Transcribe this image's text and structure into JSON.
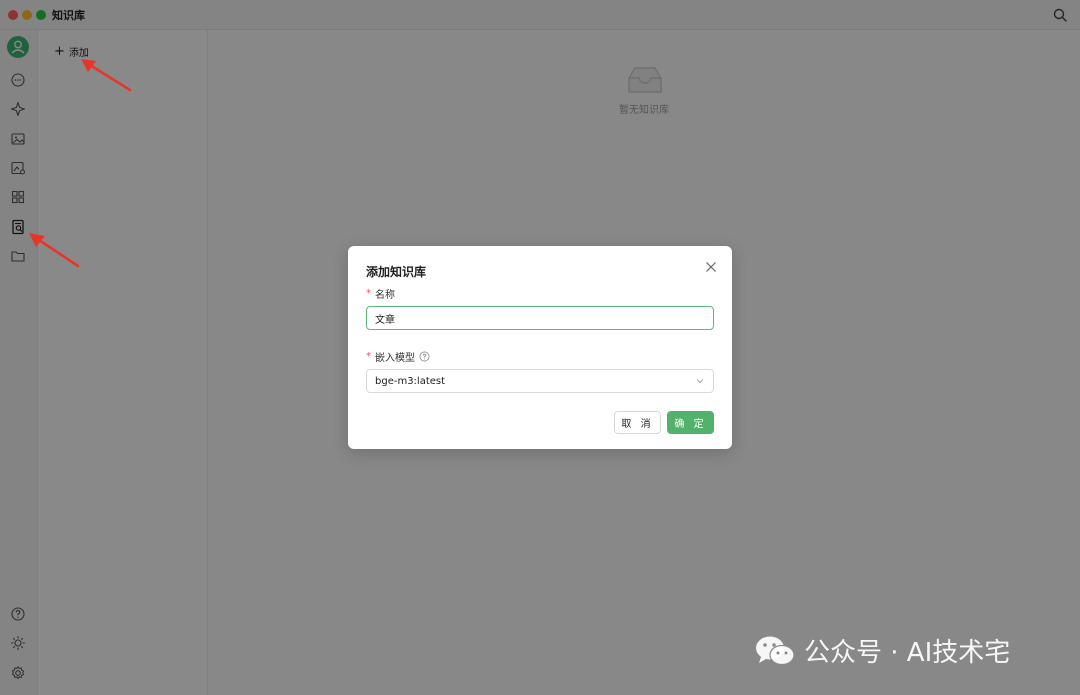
{
  "window": {
    "title": "知识库"
  },
  "sidebar": {
    "icons": [
      "user-avatar-icon",
      "chat-icon",
      "sparkle-icon",
      "image-icon",
      "image-edit-icon",
      "apps-grid-icon",
      "knowledge-base-icon",
      "folder-icon",
      "help-icon",
      "theme-sun-icon",
      "settings-gear-icon"
    ]
  },
  "kb_panel": {
    "add_label": "添加"
  },
  "main": {
    "empty_text": "暂无知识库"
  },
  "modal": {
    "title": "添加知识库",
    "name_label": "名称",
    "name_value": "文章",
    "model_label": "嵌入模型",
    "model_value": "bge-m3:latest",
    "cancel_label": "取 消",
    "ok_label": "确 定"
  },
  "watermark": {
    "text": "公众号 · AI技术宅"
  },
  "colors": {
    "accent": "#52b26b",
    "arrow": "#e8352b",
    "required": "#ff4d4f"
  }
}
